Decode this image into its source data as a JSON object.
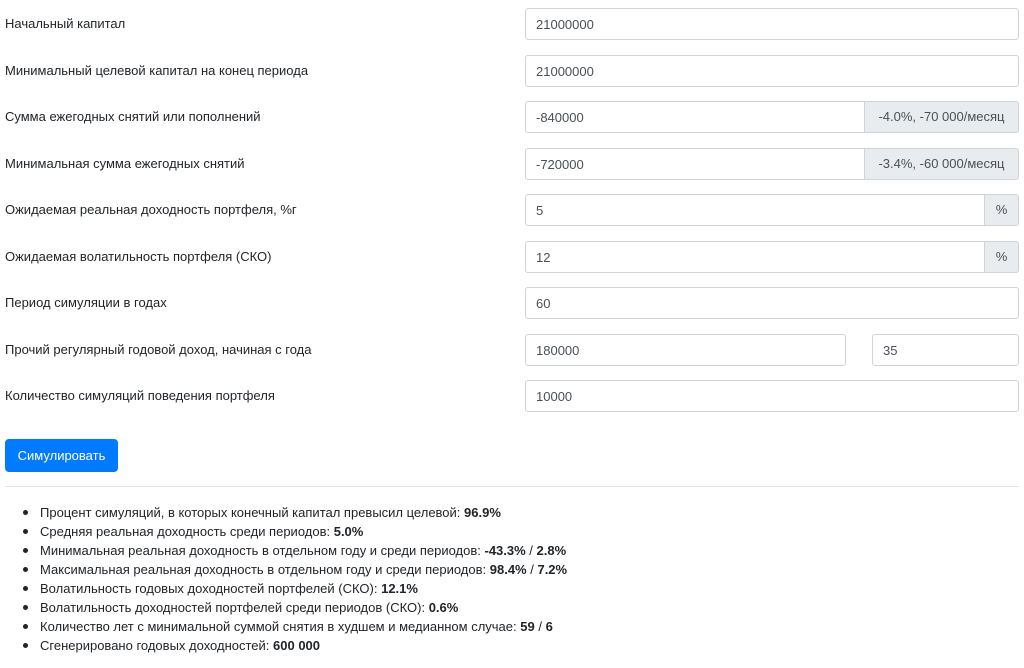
{
  "form": {
    "initial_capital": {
      "label": "Начальный капитал",
      "value": "21000000"
    },
    "min_target_capital": {
      "label": "Минимальный целевой капитал на конец периода",
      "value": "21000000"
    },
    "annual_withdrawals": {
      "label": "Сумма ежегодных снятий или пополнений",
      "value": "-840000",
      "addon": "-4.0%, -70 000/месяц"
    },
    "min_annual_withdrawal": {
      "label": "Минимальная сумма ежегодных снятий",
      "value": "-720000",
      "addon": "-3.4%, -60 000/месяц"
    },
    "expected_return": {
      "label": "Ожидаемая реальная доходность портфеля, %г",
      "value": "5",
      "addon": "%"
    },
    "expected_volatility": {
      "label": "Ожидаемая волатильность портфеля (СКО)",
      "value": "12",
      "addon": "%"
    },
    "simulation_period": {
      "label": "Период симуляции в годах",
      "value": "60"
    },
    "other_income": {
      "label": "Прочий регулярный годовой доход, начиная с года",
      "amount": "180000",
      "start_year": "35"
    },
    "simulation_count": {
      "label": "Количество симуляций поведения портфеля",
      "value": "10000"
    }
  },
  "simulate_button": "Симулировать",
  "results": [
    {
      "text": "Процент симуляций, в которых конечный капитал превысил целевой: ",
      "v1": "96.9%"
    },
    {
      "text": "Средняя реальная доходность среди периодов: ",
      "v1": "5.0%"
    },
    {
      "text": "Минимальная реальная доходность в отдельном году и среди периодов: ",
      "v1": "-43.3%",
      "sep": " / ",
      "v2": "2.8%"
    },
    {
      "text": "Максимальная реальная доходность в отдельном году и среди периодов: ",
      "v1": "98.4%",
      "sep": " / ",
      "v2": "7.2%"
    },
    {
      "text": "Волатильность годовых доходностей портфелей (СКО): ",
      "v1": "12.1%"
    },
    {
      "text": "Волатильность доходностей портфелей среди периодов (СКО): ",
      "v1": "0.6%"
    },
    {
      "text": "Количество лет с минимальной суммой снятия в худшем и медианном случае: ",
      "v1": "59",
      "sep": " / ",
      "v2": "6"
    },
    {
      "text": "Сгенерировано годовых доходностей: ",
      "v1": "600 000"
    }
  ]
}
